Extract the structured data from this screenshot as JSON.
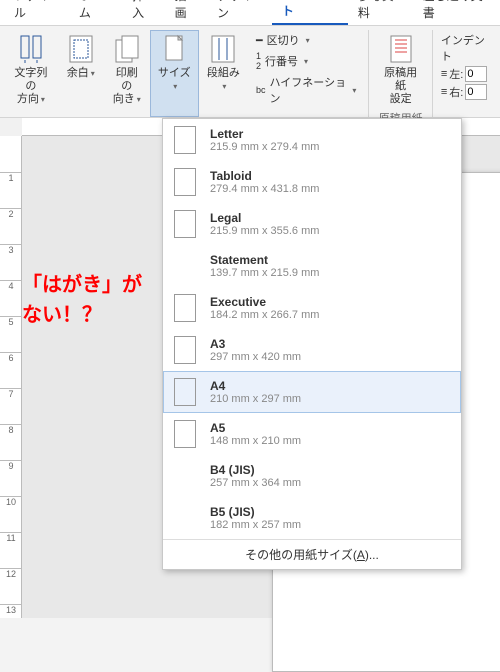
{
  "tabs": {
    "file": "ファイル",
    "home": "ホーム",
    "insert": "挿入",
    "draw": "描画",
    "design": "デザイン",
    "layout": "レイアウト",
    "reference": "参考資料",
    "mailmerge": "差し込み文書"
  },
  "ribbon": {
    "textDirection": {
      "label": "文字列の\n方向"
    },
    "margins": {
      "label": "余白"
    },
    "orientation": {
      "label": "印刷の\n向き"
    },
    "size": {
      "label": "サイズ"
    },
    "columns": {
      "label": "段組み"
    },
    "breaks": "区切り",
    "lineNumbers": "行番号",
    "hyphenation": "ハイフネーション",
    "manuscript": {
      "label": "原稿用紙\n設定",
      "group": "原稿用紙"
    },
    "indent": {
      "title": "インデント",
      "left": "左:",
      "right": "右:",
      "leftVal": "0",
      "rightVal": "0"
    }
  },
  "sizes": [
    {
      "name": "Letter",
      "dim": "215.9 mm x 279.4 mm",
      "wide": false
    },
    {
      "name": "Tabloid",
      "dim": "279.4 mm x 431.8 mm",
      "wide": false
    },
    {
      "name": "Legal",
      "dim": "215.9 mm x 355.6 mm",
      "wide": false
    },
    {
      "name": "Statement",
      "dim": "139.7 mm x 215.9 mm",
      "wide": false,
      "hideThumb": true
    },
    {
      "name": "Executive",
      "dim": "184.2 mm x 266.7 mm",
      "wide": false
    },
    {
      "name": "A3",
      "dim": "297 mm x 420 mm",
      "wide": false
    },
    {
      "name": "A4",
      "dim": "210 mm x 297 mm",
      "wide": false,
      "selected": true
    },
    {
      "name": "A5",
      "dim": "148 mm x 210 mm",
      "wide": false
    },
    {
      "name": "B4 (JIS)",
      "dim": "257 mm x 364 mm",
      "wide": false,
      "hideThumb": true
    },
    {
      "name": "B5 (JIS)",
      "dim": "182 mm x 257 mm",
      "wide": false,
      "hideThumb": true
    }
  ],
  "moreSizes": {
    "prefix": "その他の用紙サイズ(",
    "hot": "A",
    "suffix": ")..."
  },
  "annotation": {
    "line1": "「はがき」が",
    "line2": " ない！？"
  }
}
